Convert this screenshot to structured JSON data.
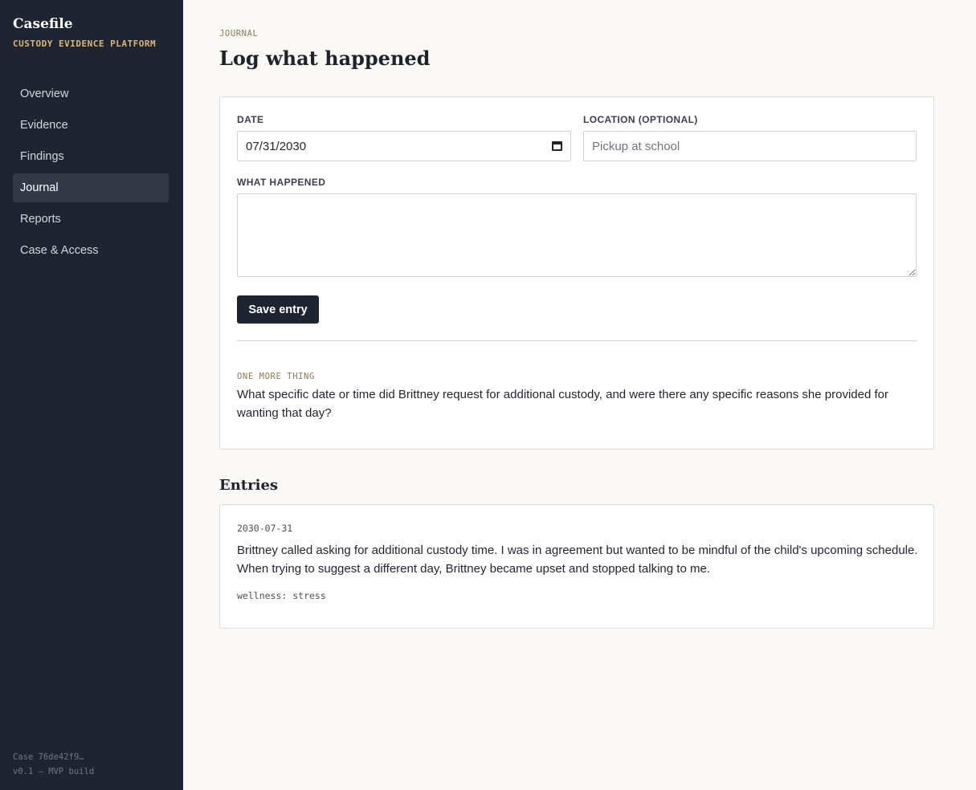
{
  "sidebar": {
    "brand_name": "Casefile",
    "brand_tagline": "CUSTODY EVIDENCE PLATFORM",
    "items": [
      {
        "label": "Overview"
      },
      {
        "label": "Evidence"
      },
      {
        "label": "Findings"
      },
      {
        "label": "Journal",
        "active": true
      },
      {
        "label": "Reports"
      },
      {
        "label": "Case & Access"
      }
    ],
    "footer_case": "Case 76de42f9…",
    "footer_version": "v0.1 — MVP build"
  },
  "header": {
    "eyebrow": "JOURNAL",
    "title": "Log what happened"
  },
  "form": {
    "date_label": "DATE",
    "date_value": "07/31/2030",
    "location_label": "LOCATION (OPTIONAL)",
    "location_placeholder": "Pickup at school",
    "location_value": "",
    "what_label": "WHAT HAPPENED",
    "what_value": "",
    "save_label": "Save entry",
    "hint_eyebrow": "ONE MORE THING",
    "hint_text": "What specific date or time did Brittney request for additional custody, and were there any specific reasons she provided for wanting that day?"
  },
  "entries": {
    "title": "Entries",
    "items": [
      {
        "date": "2030-07-31",
        "text": "Brittney called asking for additional custody time. I was in agreement but wanted to be mindful of the child's upcoming schedule. When trying to suggest a different day, Brittney became upset and stopped talking to me.",
        "tags": "wellness: stress"
      }
    ]
  },
  "colors": {
    "sidebar_bg": "#1f2431",
    "accent_gold": "#d9b873",
    "page_bg": "#faf9f6",
    "button_bg": "#1f2431"
  },
  "icons": {
    "date_picker": "calendar-icon"
  }
}
